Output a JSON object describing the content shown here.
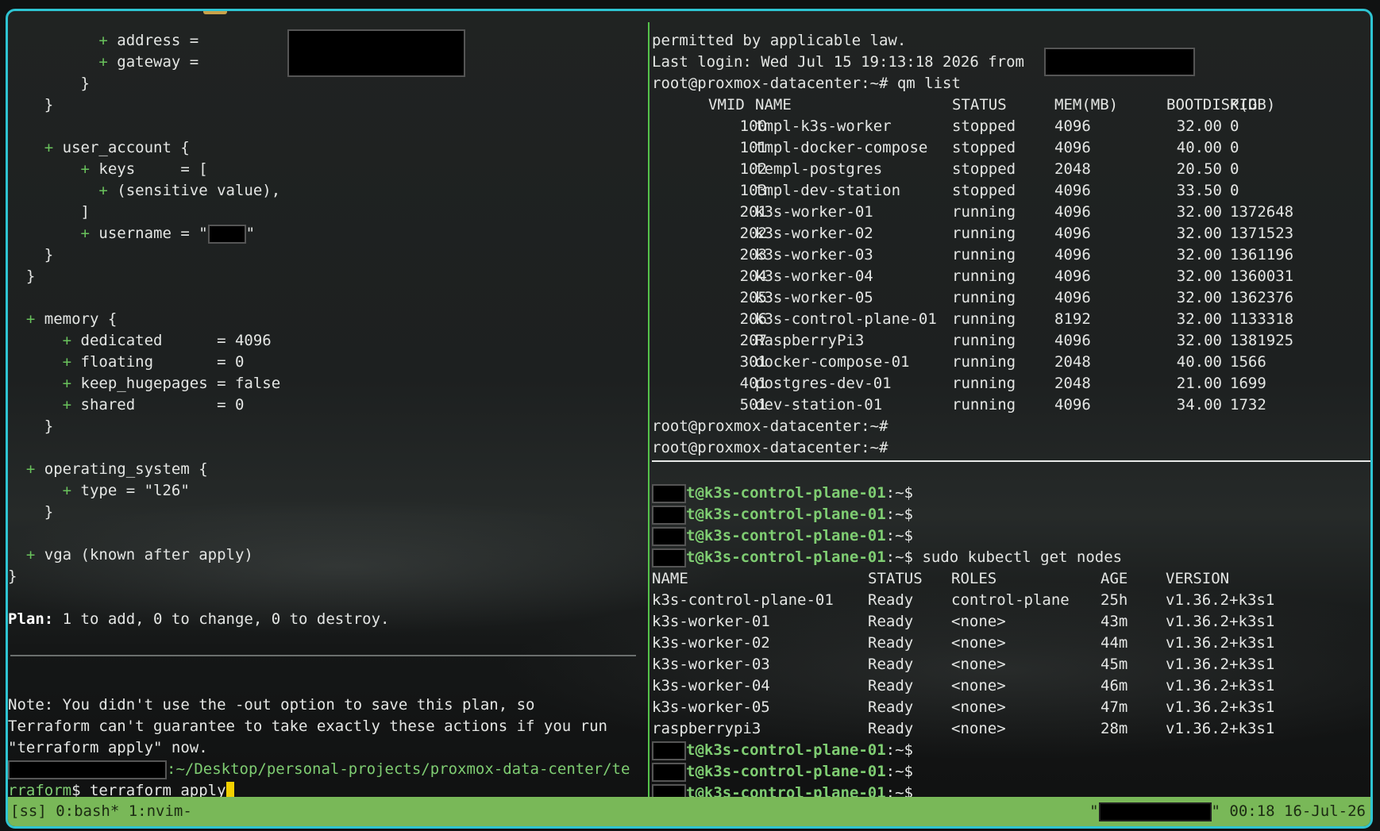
{
  "left_pane": {
    "lines": [
      "          + address = ",
      "          + gateway = ",
      "        }",
      "    }",
      "",
      "    + user_account {",
      "        + keys     = [",
      "          + (sensitive value),",
      "        ]",
      "        + username = \"",
      "    }",
      "  }",
      "",
      "  + memory {",
      "      + dedicated      = 4096",
      "      + floating       = 0",
      "      + keep_hugepages = false",
      "      + shared         = 0",
      "    }",
      "",
      "  + operating_system {",
      "      + type = \"l26\"",
      "    }",
      "",
      "  + vga (known after apply)",
      "}"
    ],
    "plan_label": "Plan:",
    "plan_text": " 1 to add, 0 to change, 0 to destroy.",
    "note_lines": [
      "Note: You didn't use the -out option to save this plan, so",
      "Terraform can't guarantee to take exactly these actions if you run",
      "\"terraform apply\" now."
    ],
    "prompt_path_1": ":~/Desktop/personal-projects/proxmox-data-center/te",
    "prompt_path_2": "rraform",
    "prompt_symbol": "$ ",
    "command": "terraform apply"
  },
  "right_top_pane": {
    "pre_lines": [
      "permitted by applicable law.",
      "Last login: Wed Jul 15 19:13:18 2026 from ",
      "root@proxmox-datacenter:~# qm list"
    ],
    "headers": [
      "VMID",
      "NAME",
      "STATUS",
      "MEM(MB)",
      "BOOTDISK(GB)",
      "PID"
    ],
    "rows": [
      [
        "100",
        "tmpl-k3s-worker",
        "stopped",
        "4096",
        "32.00",
        "0"
      ],
      [
        "101",
        "tmpl-docker-compose",
        "stopped",
        "4096",
        "40.00",
        "0"
      ],
      [
        "102",
        "templ-postgres",
        "stopped",
        "2048",
        "20.50",
        "0"
      ],
      [
        "103",
        "tmpl-dev-station",
        "stopped",
        "4096",
        "33.50",
        "0"
      ],
      [
        "201",
        "k3s-worker-01",
        "running",
        "4096",
        "32.00",
        "1372648"
      ],
      [
        "202",
        "k3s-worker-02",
        "running",
        "4096",
        "32.00",
        "1371523"
      ],
      [
        "203",
        "k3s-worker-03",
        "running",
        "4096",
        "32.00",
        "1361196"
      ],
      [
        "204",
        "k3s-worker-04",
        "running",
        "4096",
        "32.00",
        "1360031"
      ],
      [
        "205",
        "k3s-worker-05",
        "running",
        "4096",
        "32.00",
        "1362376"
      ],
      [
        "206",
        "k3s-control-plane-01",
        "running",
        "8192",
        "32.00",
        "1133318"
      ],
      [
        "207",
        "RaspberryPi3",
        "running",
        "4096",
        "32.00",
        "1381925"
      ],
      [
        "301",
        "docker-compose-01",
        "running",
        "2048",
        "40.00",
        "1566"
      ],
      [
        "401",
        "postgres-dev-01",
        "running",
        "2048",
        "21.00",
        "1699"
      ],
      [
        "501",
        "dev-station-01",
        "running",
        "4096",
        "34.00",
        "1732"
      ]
    ],
    "post_lines": [
      "root@proxmox-datacenter:~#",
      "root@proxmox-datacenter:~#"
    ]
  },
  "right_bottom_pane": {
    "host_prompt": "t@k3s-control-plane-01",
    "prompt_suffix": ":~$",
    "kubectl_command": " sudo kubectl get nodes",
    "headers": [
      "NAME",
      "STATUS",
      "ROLES",
      "AGE",
      "VERSION"
    ],
    "rows": [
      [
        "k3s-control-plane-01",
        "Ready",
        "control-plane",
        "25h",
        "v1.36.2+k3s1"
      ],
      [
        "k3s-worker-01",
        "Ready",
        "<none>",
        "43m",
        "v1.36.2+k3s1"
      ],
      [
        "k3s-worker-02",
        "Ready",
        "<none>",
        "44m",
        "v1.36.2+k3s1"
      ],
      [
        "k3s-worker-03",
        "Ready",
        "<none>",
        "45m",
        "v1.36.2+k3s1"
      ],
      [
        "k3s-worker-04",
        "Ready",
        "<none>",
        "46m",
        "v1.36.2+k3s1"
      ],
      [
        "k3s-worker-05",
        "Ready",
        "<none>",
        "47m",
        "v1.36.2+k3s1"
      ],
      [
        "raspberrypi3",
        "Ready",
        "<none>",
        "28m",
        "v1.36.2+k3s1"
      ]
    ]
  },
  "status_bar": {
    "left": "[ss] 0:bash* 1:nvim-",
    "quote_open": "\"",
    "quote_close": "\"",
    "clock": " 00:18 16-Jul-26"
  },
  "colors": {
    "border": "#2ec4d2",
    "status_bar_bg": "#79b858",
    "plus_green": "#69c25c",
    "cursor": "#f2d000"
  }
}
